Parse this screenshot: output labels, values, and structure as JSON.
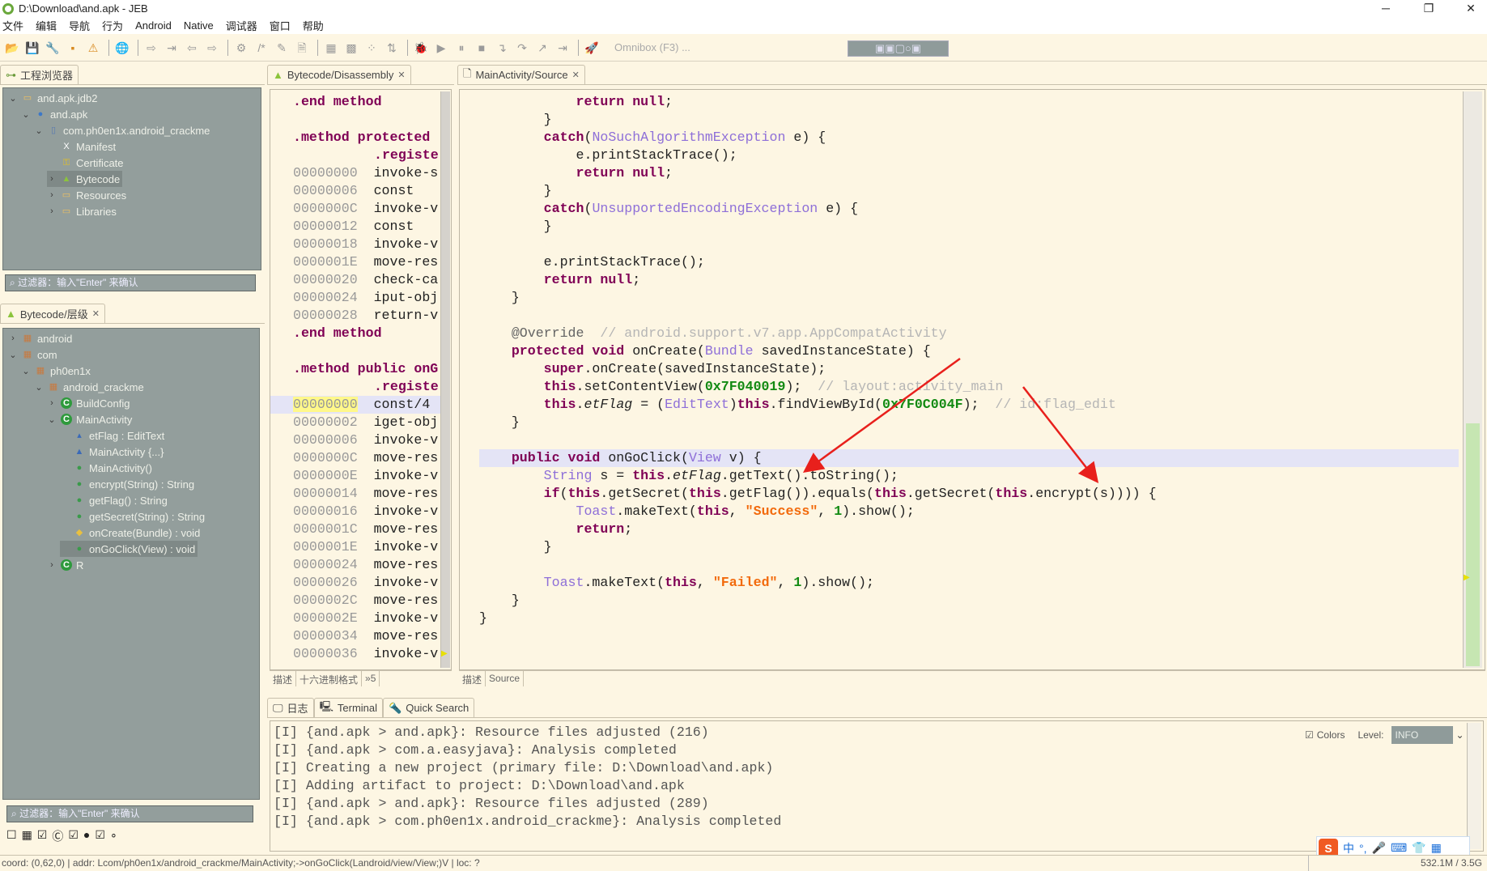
{
  "window": {
    "title": "D:\\Download\\and.apk - JEB",
    "minimize": "─",
    "maximize": "❐",
    "close": "✕"
  },
  "menu": [
    "文件",
    "编辑",
    "导航",
    "行为",
    "Android",
    "Native",
    "调试器",
    "窗口",
    "帮助"
  ],
  "toolbar": {
    "icons": [
      "open-folder-icon",
      "save-icon",
      "wrench-icon",
      "window-icon",
      "warning-icon",
      "|",
      "globe-icon",
      "|",
      "jump-to-icon",
      "jump-into-icon",
      "back-arrow-icon",
      "forward-arrow-icon",
      "|",
      "gears-icon",
      "comment-icon",
      "pencil-icon",
      "document-icon",
      "|",
      "grid-icon",
      "classes-icon",
      "nodes-icon",
      "structure-icon",
      "|",
      "bug-icon",
      "run-icon",
      "pause-icon",
      "stop-icon",
      "step-into-icon",
      "step-over-icon",
      "step-out-icon",
      "run-to-line-icon",
      "|",
      "rocket-icon"
    ],
    "glyphs": [
      "📂",
      "💾",
      "🔧",
      "▪",
      "⚠",
      "|",
      "🌐",
      "|",
      "⇨",
      "⇥",
      "⇦",
      "⇨",
      "|",
      "⚙",
      "/*",
      "✎",
      "🗎",
      "|",
      "▦",
      "▩",
      "⁘",
      "⇅",
      "|",
      "🐞",
      "▶",
      "⏸",
      "■",
      "↴",
      "↷",
      "↗",
      "⇥",
      "|",
      "🚀"
    ],
    "omnibox": "Omnibox (F3) ..."
  },
  "perspective_bar": "▣▣▢○▣",
  "project_explorer": {
    "tab": "工程浏览器",
    "items": [
      {
        "label": "and.apk.jdb2",
        "level": 0,
        "exp": "open",
        "icon": "folder-icon",
        "color": "#f0c060",
        "glyph": "▭"
      },
      {
        "label": "and.apk",
        "level": 1,
        "exp": "open",
        "icon": "apk-icon",
        "color": "#3c78c8",
        "glyph": "●"
      },
      {
        "label": "com.ph0en1x.android_crackme",
        "level": 2,
        "exp": "open",
        "icon": "package-icon",
        "color": "#5a7ab0",
        "glyph": "▯"
      },
      {
        "label": "Manifest",
        "level": 3,
        "exp": "",
        "icon": "manifest-icon",
        "color": "#fff",
        "glyph": "X"
      },
      {
        "label": "Certificate",
        "level": 3,
        "exp": "",
        "icon": "key-icon",
        "color": "#e6c020",
        "glyph": "⚿"
      },
      {
        "label": "Bytecode",
        "level": 3,
        "exp": "closed",
        "icon": "android-icon",
        "color": "#8cc43c",
        "glyph": "▲",
        "selected": true
      },
      {
        "label": "Resources",
        "level": 3,
        "exp": "closed",
        "icon": "folder-icon",
        "color": "#f0c060",
        "glyph": "▭"
      },
      {
        "label": "Libraries",
        "level": 3,
        "exp": "closed",
        "icon": "folder-icon",
        "color": "#f0c060",
        "glyph": "▭"
      }
    ],
    "filter": "过滤器：输入\"Enter\" 来确认"
  },
  "hierarchy": {
    "tab": "Bytecode/层级",
    "items": [
      {
        "label": "android",
        "level": 0,
        "exp": "closed",
        "icon": "package-icon",
        "color": "#c87a40",
        "glyph": "▦"
      },
      {
        "label": "com",
        "level": 0,
        "exp": "open",
        "icon": "package-icon",
        "color": "#c87a40",
        "glyph": "▦"
      },
      {
        "label": "ph0en1x",
        "level": 1,
        "exp": "open",
        "icon": "package-icon",
        "color": "#c87a40",
        "glyph": "▦"
      },
      {
        "label": "android_crackme",
        "level": 2,
        "exp": "open",
        "icon": "package-icon",
        "color": "#c87a40",
        "glyph": "▦"
      },
      {
        "label": "BuildConfig",
        "level": 3,
        "exp": "closed",
        "icon": "class-icon",
        "color": "#2e9a3c",
        "glyph": "C"
      },
      {
        "label": "MainActivity",
        "level": 3,
        "exp": "open",
        "icon": "class-icon",
        "color": "#2e9a3c",
        "glyph": "C"
      },
      {
        "label": "etFlag : EditText",
        "level": 4,
        "exp": "",
        "icon": "field-icon",
        "color": "#3a6ab8",
        "glyph": "▴"
      },
      {
        "label": "MainActivity {...}",
        "level": 4,
        "exp": "",
        "icon": "static-init-icon",
        "color": "#3a6ab8",
        "glyph": "▲"
      },
      {
        "label": "MainActivity()",
        "level": 4,
        "exp": "",
        "icon": "constructor-icon",
        "color": "#3a9a4a",
        "glyph": "●"
      },
      {
        "label": "encrypt(String) : String",
        "level": 4,
        "exp": "",
        "icon": "native-method-icon",
        "color": "#3a9a4a",
        "glyph": "●"
      },
      {
        "label": "getFlag() : String",
        "level": 4,
        "exp": "",
        "icon": "native-method-icon",
        "color": "#3a9a4a",
        "glyph": "●"
      },
      {
        "label": "getSecret(String) : String",
        "level": 4,
        "exp": "",
        "icon": "method-icon",
        "color": "#3a9a4a",
        "glyph": "●"
      },
      {
        "label": "onCreate(Bundle) : void",
        "level": 4,
        "exp": "",
        "icon": "protected-method-icon",
        "color": "#e8c040",
        "glyph": "◆"
      },
      {
        "label": "onGoClick(View) : void",
        "level": 4,
        "exp": "",
        "icon": "method-icon",
        "color": "#3a9a4a",
        "glyph": "●",
        "selected": true
      },
      {
        "label": "R",
        "level": 3,
        "exp": "closed",
        "icon": "class-icon",
        "color": "#2e9a3c",
        "glyph": "C"
      }
    ],
    "filter": "过滤器：输入\"Enter\" 来确认",
    "filter_toggles": [
      {
        "icon": "checkbox-icon",
        "glyph": "☐"
      },
      {
        "icon": "package-filter-icon",
        "glyph": "▦"
      },
      {
        "icon": "checkbox-checked-icon",
        "glyph": "☑"
      },
      {
        "icon": "class-filter-icon",
        "glyph": "Ⓒ"
      },
      {
        "icon": "checkbox-checked-icon",
        "glyph": "☑"
      },
      {
        "icon": "method-filter-icon",
        "glyph": "●"
      },
      {
        "icon": "checkbox-checked-icon",
        "glyph": "☑"
      },
      {
        "icon": "field-filter-icon",
        "glyph": "∘"
      }
    ]
  },
  "disassembly": {
    "tab": "Bytecode/Disassembly",
    "lines": [
      {
        "dir": ".end method"
      },
      {},
      {
        "dir": ".method protected"
      },
      {
        "dir2": ".registe"
      },
      {
        "addr": "00000000",
        "ins": "invoke-s"
      },
      {
        "addr": "00000006",
        "ins": "const"
      },
      {
        "addr": "0000000C",
        "ins": "invoke-v"
      },
      {
        "addr": "00000012",
        "ins": "const"
      },
      {
        "addr": "00000018",
        "ins": "invoke-v"
      },
      {
        "addr": "0000001E",
        "ins": "move-res"
      },
      {
        "addr": "00000020",
        "ins": "check-ca"
      },
      {
        "addr": "00000024",
        "ins": "iput-obj"
      },
      {
        "addr": "00000028",
        "ins": "return-v"
      },
      {
        "dir": ".end method"
      },
      {},
      {
        "dir": ".method public onG"
      },
      {
        "dir2": ".registe"
      },
      {
        "addr": "00000000",
        "ins": "const/4",
        "current": true
      },
      {
        "addr": "00000002",
        "ins": "iget-obj"
      },
      {
        "addr": "00000006",
        "ins": "invoke-v"
      },
      {
        "addr": "0000000C",
        "ins": "move-res"
      },
      {
        "addr": "0000000E",
        "ins": "invoke-v"
      },
      {
        "addr": "00000014",
        "ins": "move-res"
      },
      {
        "addr": "00000016",
        "ins": "invoke-v"
      },
      {
        "addr": "0000001C",
        "ins": "move-res"
      },
      {
        "addr": "0000001E",
        "ins": "invoke-v"
      },
      {
        "addr": "00000024",
        "ins": "move-res"
      },
      {
        "addr": "00000026",
        "ins": "invoke-v"
      },
      {
        "addr": "0000002C",
        "ins": "move-res"
      },
      {
        "addr": "0000002E",
        "ins": "invoke-v"
      },
      {
        "addr": "00000034",
        "ins": "move-res"
      },
      {
        "addr": "00000036",
        "ins": "invoke-v"
      }
    ],
    "bottom_tabs": [
      "描述",
      "十六进制格式",
      "»5"
    ]
  },
  "source": {
    "tab": "MainActivity/Source",
    "highlight_line": 20,
    "lines": [
      [
        [
          "",
          "            "
        ],
        [
          "kw",
          "return null"
        ],
        [
          "",
          ";"
        ]
      ],
      [
        [
          "",
          "        }"
        ]
      ],
      [
        [
          "",
          "        "
        ],
        [
          "kw",
          "catch"
        ],
        [
          "",
          "("
        ],
        [
          "ty",
          "NoSuchAlgorithmException"
        ],
        [
          "",
          " e) {"
        ]
      ],
      [
        [
          "",
          "            e.printStackTrace();"
        ]
      ],
      [
        [
          "",
          "            "
        ],
        [
          "kw",
          "return null"
        ],
        [
          "",
          ";"
        ]
      ],
      [
        [
          "",
          "        }"
        ]
      ],
      [
        [
          "",
          "        "
        ],
        [
          "kw",
          "catch"
        ],
        [
          "",
          "("
        ],
        [
          "ty",
          "UnsupportedEncodingException"
        ],
        [
          "",
          " e) {"
        ]
      ],
      [
        [
          "",
          "        }"
        ]
      ],
      [],
      [
        [
          "",
          "        e.printStackTrace();"
        ]
      ],
      [
        [
          "",
          "        "
        ],
        [
          "kw",
          "return null"
        ],
        [
          "",
          ";"
        ]
      ],
      [
        [
          "",
          "    }"
        ]
      ],
      [],
      [
        [
          "",
          "    "
        ],
        [
          "an",
          "@Override"
        ],
        [
          "cm",
          "  // android.support.v7.app.AppCompatActivity"
        ]
      ],
      [
        [
          "",
          "    "
        ],
        [
          "kw",
          "protected void"
        ],
        [
          "",
          " onCreate("
        ],
        [
          "ty",
          "Bundle"
        ],
        [
          "",
          " savedInstanceState) {"
        ]
      ],
      [
        [
          "",
          "        "
        ],
        [
          "kw",
          "super"
        ],
        [
          "",
          ".onCreate(savedInstanceState);"
        ]
      ],
      [
        [
          "",
          "        "
        ],
        [
          "kw",
          "this"
        ],
        [
          "",
          ".setContentView("
        ],
        [
          "nu",
          "0x7F040019"
        ],
        [
          "",
          ");"
        ],
        [
          "cm",
          "  // layout:activity_main"
        ]
      ],
      [
        [
          "",
          "        "
        ],
        [
          "kw",
          "this"
        ],
        [
          "",
          "."
        ],
        [
          "fi",
          "etFlag"
        ],
        [
          "",
          " = ("
        ],
        [
          "ty",
          "EditText"
        ],
        [
          "",
          ")"
        ],
        [
          "kw",
          "this"
        ],
        [
          "",
          ".findViewById("
        ],
        [
          "nu",
          "0x7F0C004F"
        ],
        [
          "",
          ");"
        ],
        [
          "cm",
          "  // id:flag_edit"
        ]
      ],
      [
        [
          "",
          "    }"
        ]
      ],
      [],
      [
        [
          "",
          "    "
        ],
        [
          "kw",
          "public void"
        ],
        [
          "",
          " onGoClick("
        ],
        [
          "ty",
          "View"
        ],
        [
          "",
          " v) {"
        ]
      ],
      [
        [
          "",
          "        "
        ],
        [
          "ty",
          "String"
        ],
        [
          "",
          " s = "
        ],
        [
          "kw",
          "this"
        ],
        [
          "",
          "."
        ],
        [
          "fi",
          "etFlag"
        ],
        [
          "",
          ".getText().toString();"
        ]
      ],
      [
        [
          "",
          "        "
        ],
        [
          "kw",
          "if"
        ],
        [
          "",
          "("
        ],
        [
          "kw",
          "this"
        ],
        [
          "",
          ".getSecret("
        ],
        [
          "kw",
          "this"
        ],
        [
          "",
          ".getFlag()).equals("
        ],
        [
          "kw",
          "this"
        ],
        [
          "",
          ".getSecret("
        ],
        [
          "kw",
          "this"
        ],
        [
          "",
          ".encrypt(s)))) {"
        ]
      ],
      [
        [
          "",
          "            "
        ],
        [
          "ty",
          "Toast"
        ],
        [
          "",
          ".makeText("
        ],
        [
          "kw",
          "this"
        ],
        [
          "",
          ", "
        ],
        [
          "st",
          "\"Success\""
        ],
        [
          "",
          ", "
        ],
        [
          "nu",
          "1"
        ],
        [
          "",
          ").show();"
        ]
      ],
      [
        [
          "",
          "            "
        ],
        [
          "kw",
          "return"
        ],
        [
          "",
          ";"
        ]
      ],
      [
        [
          "",
          "        }"
        ]
      ],
      [],
      [
        [
          "",
          "        "
        ],
        [
          "ty",
          "Toast"
        ],
        [
          "",
          ".makeText("
        ],
        [
          "kw",
          "this"
        ],
        [
          "",
          ", "
        ],
        [
          "st",
          "\"Failed\""
        ],
        [
          "",
          ", "
        ],
        [
          "nu",
          "1"
        ],
        [
          "",
          ").show();"
        ]
      ],
      [
        [
          "",
          "    }"
        ]
      ],
      [
        [
          "",
          "}"
        ]
      ]
    ],
    "bottom_tabs": [
      "描述",
      "Source"
    ],
    "annotation_color": "#e8201c"
  },
  "log": {
    "tabs": [
      "日志",
      "Terminal",
      "Quick Search"
    ],
    "colors_label": "Colors",
    "colors_checked": true,
    "level_label": "Level:",
    "level_value": "INFO",
    "lines": [
      "[I] {and.apk > and.apk}: Resource files adjusted (216)",
      "[I] {and.apk > com.a.easyjava}: Analysis completed",
      "[I] Creating a new project (primary file: D:\\Download\\and.apk)",
      "[I] Adding artifact to project: D:\\Download\\and.apk",
      "[I] {and.apk > and.apk}: Resource files adjusted (289)",
      "[I] {and.apk > com.ph0en1x.android_crackme}: Analysis completed"
    ]
  },
  "ime": {
    "logo": "S",
    "items": [
      "中",
      "°,",
      "🎤",
      "⌨",
      "👕",
      "▦"
    ]
  },
  "status": {
    "text": "coord: (0,62,0) | addr: Lcom/ph0en1x/android_crackme/MainActivity;->onGoClick(Landroid/view/View;)V | loc: ?",
    "memory": "532.1M / 3.5G"
  }
}
